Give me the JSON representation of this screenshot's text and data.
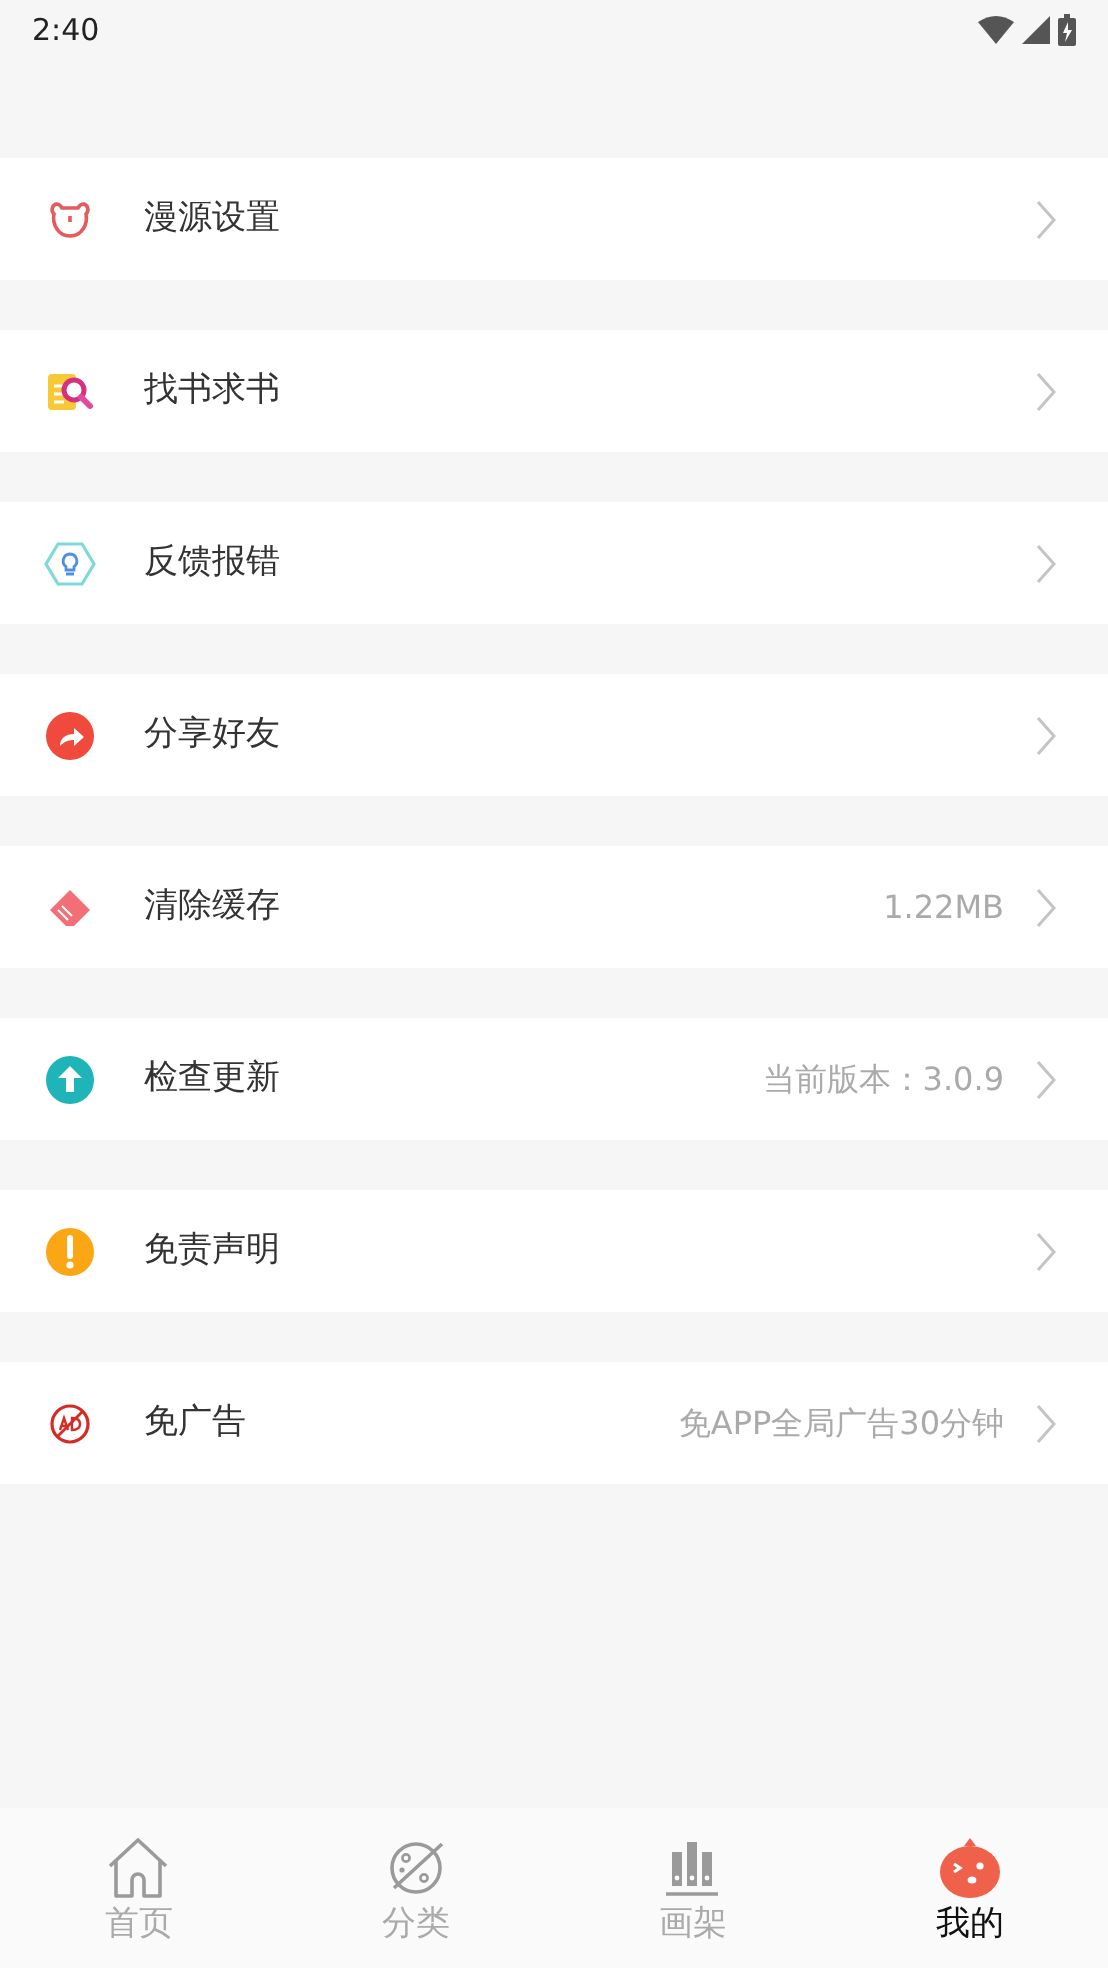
{
  "status_bar": {
    "time": "2:40"
  },
  "menu": [
    {
      "kind": "bear",
      "label": "漫源设置"
    },
    {
      "kind": "book-search",
      "label": "找书求书"
    },
    {
      "kind": "bulb",
      "label": "反馈报错"
    },
    {
      "kind": "share",
      "label": "分享好友"
    },
    {
      "kind": "eraser",
      "label": "清除缓存",
      "value": "1.22MB"
    },
    {
      "kind": "update",
      "label": "检查更新",
      "value": "当前版本：3.0.9"
    },
    {
      "kind": "notice",
      "label": "免责声明"
    },
    {
      "kind": "no-ad",
      "label": "免广告",
      "value": "免APP全局广告30分钟"
    }
  ],
  "tabs": [
    {
      "kind": "home",
      "label": "首页",
      "selected": false
    },
    {
      "kind": "planet",
      "label": "分类",
      "selected": false
    },
    {
      "kind": "shelf",
      "label": "画架",
      "selected": false
    },
    {
      "kind": "mascot",
      "label": "我的",
      "selected": true
    }
  ]
}
